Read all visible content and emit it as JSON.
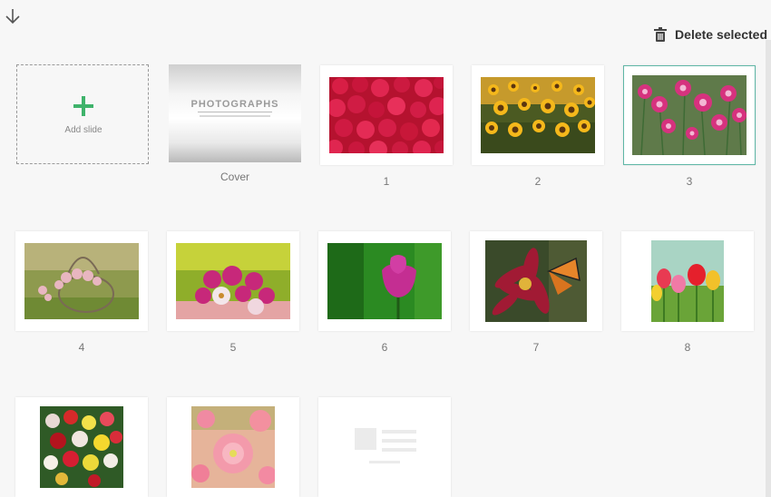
{
  "toolbar": {
    "delete_label": "Delete selected"
  },
  "add_slide": {
    "label": "Add slide"
  },
  "cover": {
    "title": "PHOTOGRAPHS",
    "caption": "Cover"
  },
  "slides": [
    {
      "caption": "1",
      "subject": "red roses"
    },
    {
      "caption": "2",
      "subject": "sunflowers"
    },
    {
      "caption": "3",
      "subject": "pink carnations",
      "selected": true
    },
    {
      "caption": "4",
      "subject": "basket of roses"
    },
    {
      "caption": "5",
      "subject": "zinnia bouquet"
    },
    {
      "caption": "6",
      "subject": "pink tulip"
    },
    {
      "caption": "7",
      "subject": "dahlia with butterfly"
    },
    {
      "caption": "8",
      "subject": "tulips"
    },
    {
      "caption": "",
      "subject": "begonias"
    },
    {
      "caption": "",
      "subject": "pink dahlias"
    },
    {
      "caption": "",
      "subject": "placeholder"
    }
  ],
  "colors": {
    "accent_green": "#3fb36b",
    "selected_border": "#5fb7a6"
  }
}
